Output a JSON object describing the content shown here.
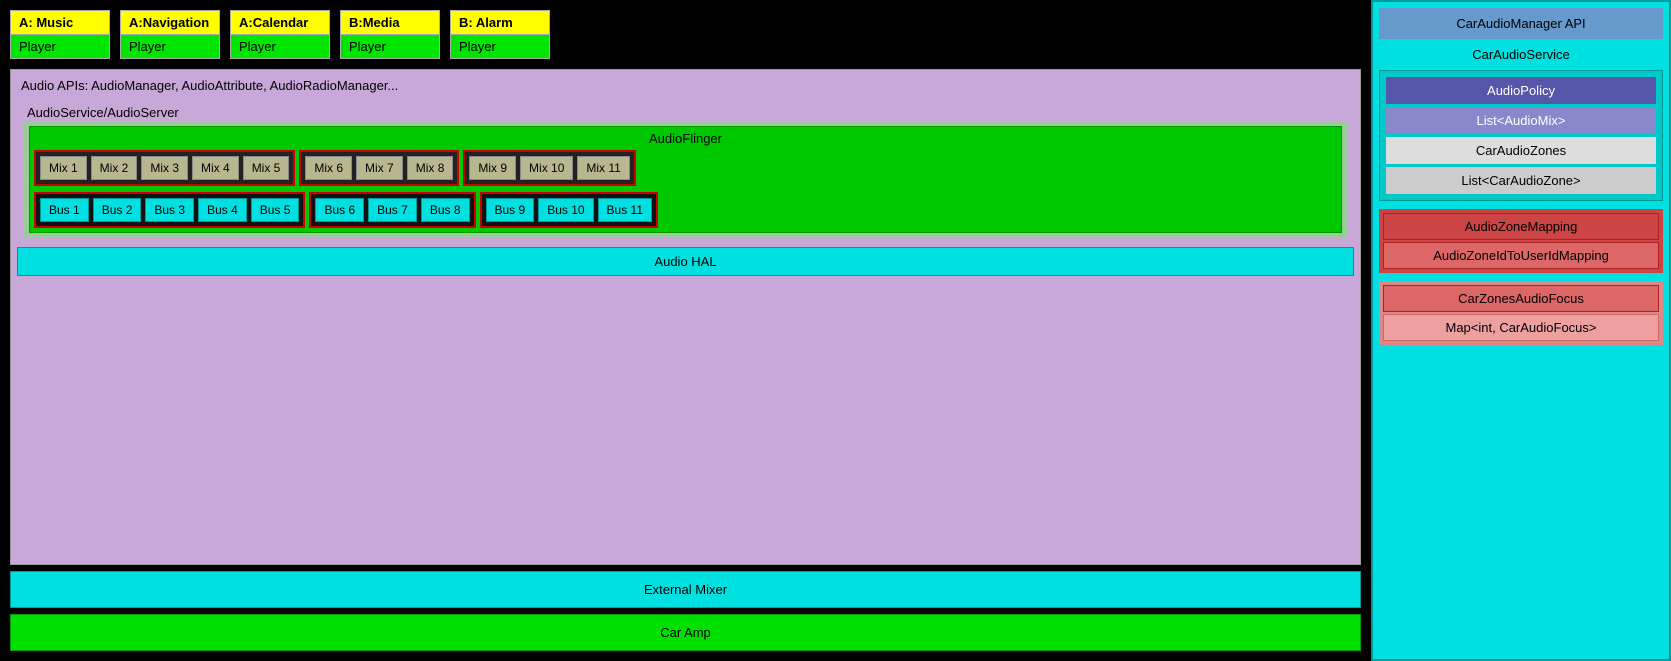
{
  "players": [
    {
      "label": "A: Music",
      "bottom": "Player"
    },
    {
      "label": "A:Navigation",
      "bottom": "Player"
    },
    {
      "label": "A:Calendar",
      "bottom": "Player"
    },
    {
      "label": "B:Media",
      "bottom": "Player"
    },
    {
      "label": "B: Alarm",
      "bottom": "Player"
    }
  ],
  "audio_api": "Audio APIs: AudioManager, AudioAttribute, AudioRadioManager...",
  "audio_service": "AudioService/AudioServer",
  "audio_flinger": "AudioFlinger",
  "audio_hal": "Audio HAL",
  "external_mixer": "External Mixer",
  "car_amp": "Car Amp",
  "mix_zones": [
    {
      "items": [
        "Mix 1",
        "Mix 2",
        "Mix 3",
        "Mix 4",
        "Mix 5"
      ]
    },
    {
      "items": [
        "Mix 6",
        "Mix 7",
        "Mix 8"
      ]
    },
    {
      "items": [
        "Mix 9",
        "Mix 10",
        "Mix 11"
      ]
    }
  ],
  "bus_zones": [
    {
      "items": [
        "Bus 1",
        "Bus 2",
        "Bus 3",
        "Bus 4",
        "Bus 5"
      ]
    },
    {
      "items": [
        "Bus 6",
        "Bus 7",
        "Bus 8"
      ]
    },
    {
      "items": [
        "Bus 9",
        "Bus 10",
        "Bus 11"
      ]
    }
  ],
  "right_panel": {
    "car_audio_manager_api": "CarAudioManager API",
    "car_audio_service": "CarAudioService",
    "audio_policy": "AudioPolicy",
    "list_audiomix": "List<AudioMix>",
    "car_audio_zones": "CarAudioZones",
    "list_caraudiozone": "List<CarAudioZone>",
    "audio_zone_mapping": "AudioZoneMapping",
    "audio_zone_id_mapping": "AudioZoneIdToUserIdMapping",
    "car_zones_audio_focus": "CarZonesAudioFocus",
    "map_car_audio_focus": "Map<int, CarAudioFocus>"
  }
}
